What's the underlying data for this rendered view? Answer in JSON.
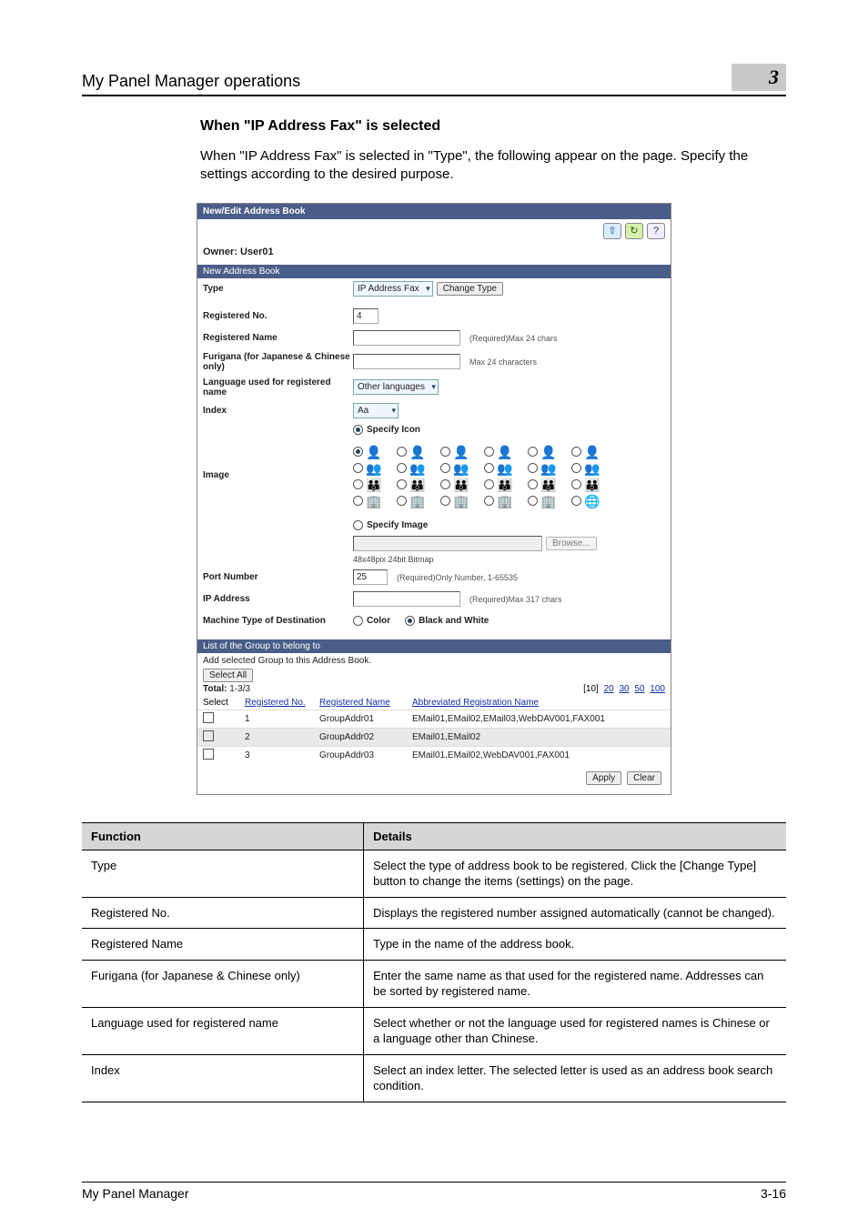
{
  "header": {
    "title": "My Panel Manager operations",
    "chapter": "3"
  },
  "section": {
    "heading": "When \"IP Address Fax\" is selected",
    "body": "When \"IP Address Fax\" is selected in \"Type\", the following appear on the page. Specify the settings according to the desired purpose."
  },
  "screenshot": {
    "titlebar": "New/Edit Address Book",
    "owner": "Owner: User01",
    "subhead1": "New Address Book",
    "labels": {
      "type": "Type",
      "registered_no": "Registered No.",
      "registered_name": "Registered Name",
      "furigana": "Furigana (for Japanese & Chinese only)",
      "language": "Language used for registered name",
      "index": "Index",
      "image": "Image",
      "port": "Port Number",
      "ip": "IP Address",
      "machine": "Machine Type of Destination"
    },
    "type_value": "IP Address Fax",
    "change_type_btn": "Change Type",
    "registered_no_value": "4",
    "reg_name_hint": "(Required)Max 24 chars",
    "furigana_hint": "Max 24 characters",
    "language_value": "Other languages",
    "index_value": "Aa",
    "specify_icon": "Specify Icon",
    "specify_image": "Specify Image",
    "browse_btn": "Browse...",
    "image_note": "48x48pix 24bit Bitmap",
    "port_value": "25",
    "port_hint": "(Required)Only Number, 1-65535",
    "ip_hint": "(Required)Max 317 chars",
    "machine_color": "Color",
    "machine_bw": "Black and White",
    "group_section_head": "List of the Group to belong to",
    "group_section_sub": "Add selected Group to this Address Book.",
    "select_all_btn": "Select All",
    "total_label": "Total:",
    "total_range": "1-3/3",
    "pager": [
      "[10]",
      "20",
      "30",
      "50",
      "100"
    ],
    "cols": {
      "select": "Select",
      "regno": "Registered No.",
      "regname": "Registered Name",
      "abbrev": "Abbreviated Registration Name"
    },
    "rows": [
      {
        "no": "1",
        "name": "GroupAddr01",
        "abbrev": "EMail01,EMail02,EMail03,WebDAV001,FAX001"
      },
      {
        "no": "2",
        "name": "GroupAddr02",
        "abbrev": "EMail01,EMail02"
      },
      {
        "no": "3",
        "name": "GroupAddr03",
        "abbrev": "EMail01,EMail02,WebDAV001,FAX001"
      }
    ],
    "apply_btn": "Apply",
    "clear_btn": "Clear"
  },
  "details": {
    "head_function": "Function",
    "head_details": "Details",
    "rows": [
      {
        "f": "Type",
        "d": "Select the type of address book to be registered. Click the [Change Type] button to change the items (settings) on the page."
      },
      {
        "f": "Registered No.",
        "d": "Displays the registered number assigned automatically (cannot be changed)."
      },
      {
        "f": "Registered Name",
        "d": "Type in the name of the address book."
      },
      {
        "f": "Furigana (for Japanese & Chinese only)",
        "d": "Enter the same name as that used for the registered name. Addresses can be sorted by registered name."
      },
      {
        "f": "Language used for registered name",
        "d": "Select whether or not the language used for registered names is Chinese or a language other than Chinese."
      },
      {
        "f": "Index",
        "d": "Select an index letter. The selected letter is used as an address book search condition."
      }
    ]
  },
  "footer": {
    "product": "My Panel Manager",
    "page": "3-16"
  }
}
